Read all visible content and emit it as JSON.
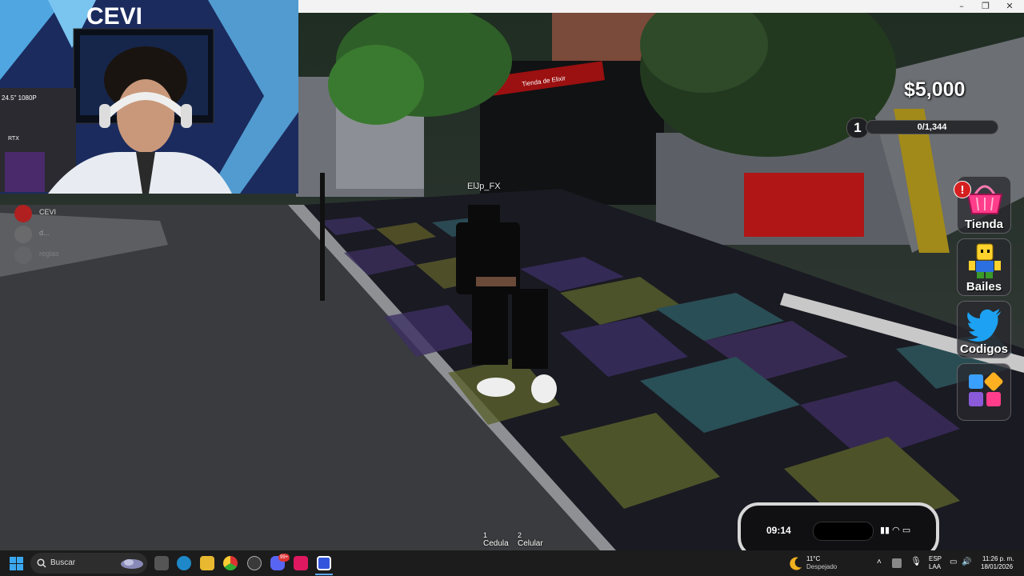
{
  "window": {
    "minimize": "–",
    "maximize": "❐",
    "close": "✕"
  },
  "player": {
    "name": "ElJp_FX"
  },
  "hud": {
    "money": "$5,000",
    "level": "1",
    "xp_text": "0/1,344",
    "xp_fraction": 0,
    "alert_badge": "!",
    "buttons": [
      {
        "label": "Tienda",
        "icon": "shopping-basket-icon"
      },
      {
        "label": "Bailes",
        "icon": "dancing-character-icon"
      },
      {
        "label": "Codigos",
        "icon": "twitter-bird-icon"
      },
      {
        "label": "",
        "icon": "grid-menu-icon"
      }
    ]
  },
  "hotbar": [
    {
      "key": "1",
      "label": "Cedula"
    },
    {
      "key": "2",
      "label": "Celular"
    }
  ],
  "phone": {
    "time": "09:14",
    "status_icons": "▮▮ ◠ ▭"
  },
  "scene": {
    "store_sign": "Tienda de Elixir"
  },
  "webcam": {
    "brand": "CEVI",
    "monitor_text": "24.5\" 1080P",
    "rtx": "RTX"
  },
  "chat": [
    {
      "name": "CEVI"
    },
    {
      "name": "d..."
    },
    {
      "name": "reglas"
    }
  ],
  "taskbar": {
    "search_placeholder": "Buscar",
    "badge": "99+",
    "weather_temp": "11°C",
    "weather_desc": "Despejado",
    "lang_top": "ESP",
    "lang_bottom": "LAA",
    "time": "11:26 p. m.",
    "date": "18/01/2026"
  },
  "colors": {
    "money_text": "#ffffff",
    "alert": "#d62020",
    "taskbar_bg": "#1c1c1c",
    "tienda_pink": "#ff3d8a",
    "twitter_blue": "#1da1f2"
  }
}
